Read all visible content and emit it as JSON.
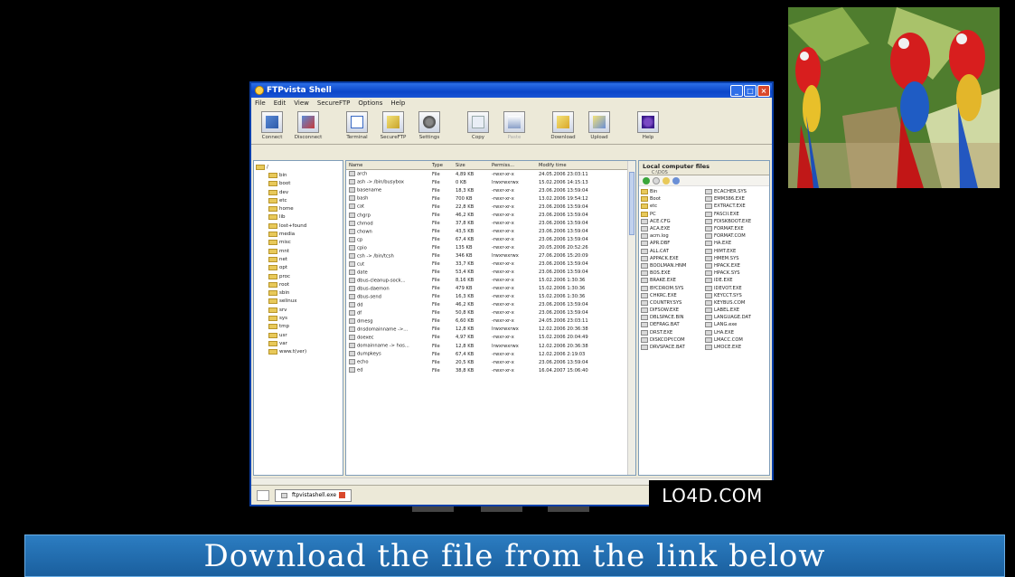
{
  "window": {
    "title": "FTPvista Shell",
    "menu": [
      "File",
      "Edit",
      "View",
      "SecureFTP",
      "Options",
      "Help"
    ],
    "toolbar": [
      {
        "label": "Connect",
        "icon": "connect-icon"
      },
      {
        "label": "Disconnect",
        "icon": "disconnect-icon"
      },
      {
        "label": "Terminal",
        "icon": "terminal-icon"
      },
      {
        "label": "SecureFTP",
        "icon": "secureftp-icon"
      },
      {
        "label": "Settings",
        "icon": "settings-icon"
      },
      {
        "label": "Copy",
        "icon": "copy-icon"
      },
      {
        "label": "Paste",
        "icon": "paste-icon"
      },
      {
        "label": "Download",
        "icon": "download-icon"
      },
      {
        "label": "Upload",
        "icon": "upload-icon"
      },
      {
        "label": "Help",
        "icon": "help-icon"
      }
    ]
  },
  "tree": {
    "root": "/",
    "items": [
      "bin",
      "boot",
      "dev",
      "etc",
      "home",
      "lib",
      "lost+found",
      "media",
      "misc",
      "mnt",
      "net",
      "opt",
      "proc",
      "root",
      "sbin",
      "selinux",
      "srv",
      "sys",
      "tmp",
      "usr",
      "var",
      "www.t(ver)"
    ]
  },
  "list": {
    "headers": [
      "Name",
      "Type",
      "Size",
      "Permiss...",
      "Modify time"
    ],
    "rows": [
      [
        "arch",
        "File",
        "4,89 KB",
        "-rwxr-xr-x",
        "24.05.2006 23:03:11"
      ],
      [
        "ash -> /bin/busybox",
        "File",
        "0 KB",
        "lrwxrwxrwx",
        "15.02.2006 14:15:13"
      ],
      [
        "basename",
        "File",
        "18,3 KB",
        "-rwxr-xr-x",
        "23.06.2006 13:59:04"
      ],
      [
        "bash",
        "File",
        "700 KB",
        "-rwxr-xr-x",
        "13.02.2006 19:54:12"
      ],
      [
        "cat",
        "File",
        "22,8 KB",
        "-rwxr-xr-x",
        "23.06.2006 13:59:04"
      ],
      [
        "chgrp",
        "File",
        "46,2 KB",
        "-rwxr-xr-x",
        "23.06.2006 13:59:04"
      ],
      [
        "chmod",
        "File",
        "37,8 KB",
        "-rwxr-xr-x",
        "23.06.2006 13:59:04"
      ],
      [
        "chown",
        "File",
        "43,5 KB",
        "-rwxr-xr-x",
        "23.06.2006 13:59:04"
      ],
      [
        "cp",
        "File",
        "67,4 KB",
        "-rwxr-xr-x",
        "23.06.2006 13:59:04"
      ],
      [
        "cpio",
        "File",
        "135 KB",
        "-rwxr-xr-x",
        "20.05.2006 20:52:26"
      ],
      [
        "csh -> /bin/tcsh",
        "File",
        "346 KB",
        "lrwxrwxrwx",
        "27.06.2006 15:20:09"
      ],
      [
        "cut",
        "File",
        "33,7 KB",
        "-rwxr-xr-x",
        "23.06.2006 13:59:04"
      ],
      [
        "date",
        "File",
        "53,4 KB",
        "-rwxr-xr-x",
        "23.06.2006 13:59:04"
      ],
      [
        "dbus-cleanup-sock...",
        "File",
        "8,16 KB",
        "-rwxr-xr-x",
        "15.02.2006 1:30:36"
      ],
      [
        "dbus-daemon",
        "File",
        "479 KB",
        "-rwxr-xr-x",
        "15.02.2006 1:30:36"
      ],
      [
        "dbus-send",
        "File",
        "16,3 KB",
        "-rwxr-xr-x",
        "15.02.2006 1:30:36"
      ],
      [
        "dd",
        "File",
        "46,2 KB",
        "-rwxr-xr-x",
        "23.06.2006 13:59:04"
      ],
      [
        "df",
        "File",
        "50,8 KB",
        "-rwxr-xr-x",
        "23.06.2006 13:59:04"
      ],
      [
        "dmesg",
        "File",
        "6,60 KB",
        "-rwxr-xr-x",
        "24.05.2006 23:03:11"
      ],
      [
        "dnsdomainname ->...",
        "File",
        "12,8 KB",
        "lrwxrwxrwx",
        "12.02.2006 20:36:38"
      ],
      [
        "doexec",
        "File",
        "4,97 KB",
        "-rwxr-xr-x",
        "15.02.2006 20:04:49"
      ],
      [
        "domainname -> hos...",
        "File",
        "12,8 KB",
        "lrwxrwxrwx",
        "12.02.2006 20:36:38"
      ],
      [
        "dumpkeys",
        "File",
        "67,4 KB",
        "-rwxr-xr-x",
        "12.02.2006 2:19:03"
      ],
      [
        "echo",
        "File",
        "20,5 KB",
        "-rwxr-xr-x",
        "23.06.2006 13:59:04"
      ],
      [
        "ed",
        "File",
        "38,8 KB",
        "-rwxr-xr-x",
        "16.04.2007 15:06:40"
      ]
    ]
  },
  "local": {
    "title": "Local computer files",
    "path": "C:\\DOS",
    "files_left": [
      "Bin",
      "Boot",
      "etc",
      "PC",
      "ACE.CFG",
      "ACA.EXE",
      "acm.log",
      "APR.DBF",
      "ALL.CAT",
      "APPACK.EXE",
      "BOOLMAN.HNM",
      "BOS.EXE",
      "BRAKE.EXE",
      "BYCDROM.SYS",
      "CHKRC.EXE",
      "COUNTRY.SYS",
      "DIFSOW.EXE",
      "DBLSPACE.BIN",
      "DEFRAG.BAT",
      "DRST.EXE",
      "DISKCOPY.COM",
      "DRVSPACE.BAT"
    ],
    "files_right": [
      "ECACHER.SYS",
      "EMM386.EXE",
      "EXTRACT.EXE",
      "FASCII.EXE",
      "FDISKBOOT.EXE",
      "FORMAT.EXE",
      "FORMAT.COM",
      "HA.EXE",
      "HIMT.EXE",
      "HMEM.SYS",
      "HPACK.EXE",
      "HPACK.SYS",
      "IDE.EXE",
      "IDEVOT.EXE",
      "KEYCCT.SYS",
      "KEYBUS.COM",
      "LABEL.EXE",
      "LANGUAGE.DAT",
      "LANG.exe",
      "LHA.EXE",
      "LMACC.COM",
      "LMOCE.EXE"
    ]
  },
  "taskbar": {
    "tab_label": "ftpvistashell.exe"
  },
  "watermark": "LO4D.COM",
  "banner": "Download the file from the link below",
  "colors": {
    "titlebar": "#0b46c9",
    "banner": "#1a5f9e",
    "background": "#000000"
  }
}
